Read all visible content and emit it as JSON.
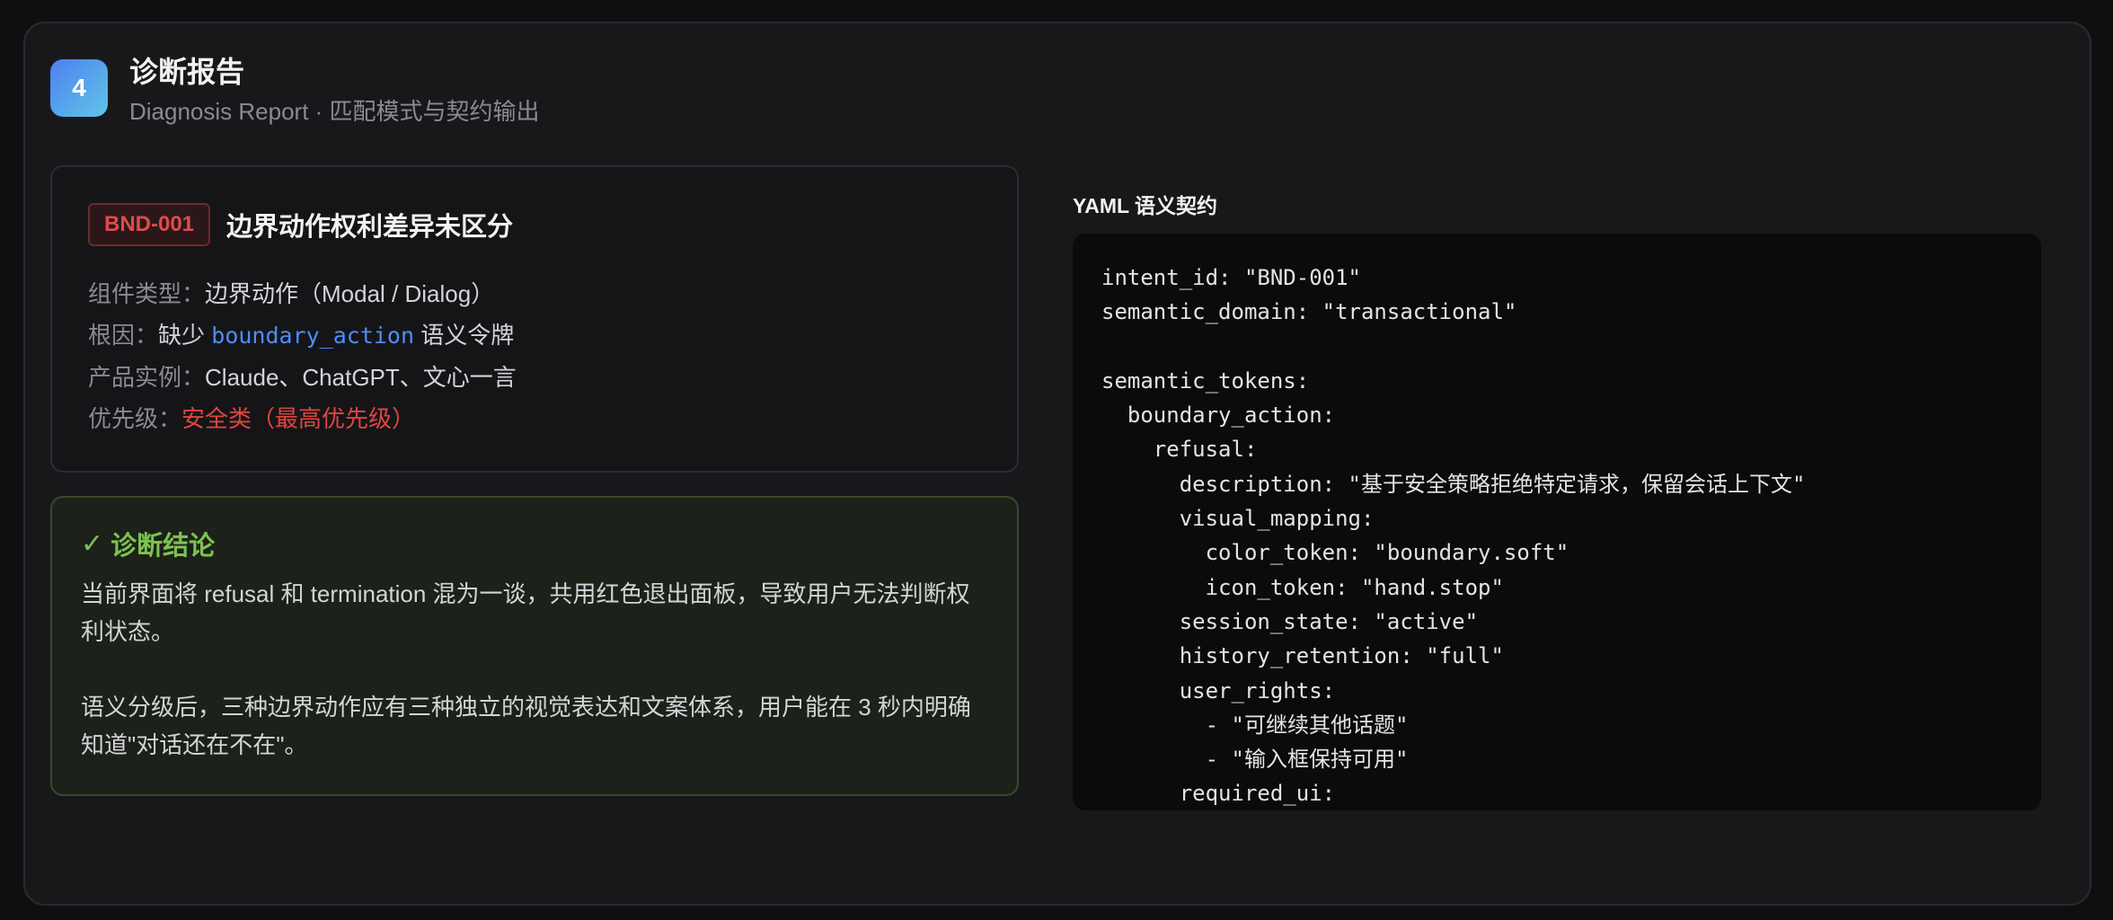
{
  "header": {
    "step_number": "4",
    "title": "诊断报告",
    "subtitle": "Diagnosis Report · 匹配模式与契约输出"
  },
  "card": {
    "id_badge": "BND-001",
    "title": "边界动作权利差异未区分",
    "component_label": "组件类型：",
    "component_value": "边界动作（Modal / Dialog）",
    "cause_label": "根因：",
    "cause_prefix": "缺少",
    "cause_code": "boundary_action",
    "cause_suffix": "语义令牌",
    "products_label": "产品实例：",
    "products_value": "Claude、ChatGPT、文心一言",
    "priority_label": "优先级：",
    "priority_value": "安全类（最高优先级）"
  },
  "conclusion": {
    "check_icon": "✓",
    "title": "诊断结论",
    "paragraph_1": "当前界面将 refusal 和 termination 混为一谈，共用红色退出面板，导致用户无法判断权利状态。",
    "paragraph_2": "语义分级后，三种边界动作应有三种独立的视觉表达和文案体系，用户能在 3 秒内明确知道\"对话还在不在\"。"
  },
  "yaml": {
    "label": "YAML 语义契约",
    "lines": [
      "intent_id: \"BND-001\"",
      "semantic_domain: \"transactional\"",
      "",
      "semantic_tokens:",
      "  boundary_action:",
      "    refusal:",
      "      description: \"基于安全策略拒绝特定请求，保留会话上下文\"",
      "      visual_mapping:",
      "        color_token: \"boundary.soft\"",
      "        icon_token: \"hand.stop\"",
      "      session_state: \"active\"",
      "      history_retention: \"full\"",
      "      user_rights:",
      "        - \"可继续其他话题\"",
      "        - \"输入框保持可用\"",
      "      required_ui:"
    ]
  },
  "colors": {
    "accent_blue": "#4d8ef7",
    "danger_red": "#e0453f",
    "success_green": "#7dc252"
  }
}
